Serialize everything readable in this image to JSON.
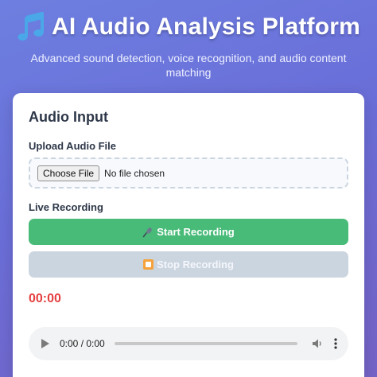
{
  "header": {
    "icon": "musical-notes-icon",
    "title": "AI Audio Analysis Platform",
    "subtitle": "Advanced sound detection, voice recognition, and audio content matching"
  },
  "audio_input": {
    "section_title": "Audio Input",
    "upload_label": "Upload Audio File",
    "choose_button": "Choose File",
    "no_file_text": "No file chosen",
    "live_label": "Live Recording",
    "start_button": "Start Recording",
    "start_icon": "microphone-icon",
    "stop_button": "Stop Recording",
    "stop_icon": "stop-icon",
    "timer": "00:00"
  },
  "player": {
    "time": "0:00 / 0:00",
    "progress": 0
  },
  "colors": {
    "start_button": "#48bb78",
    "stop_button_disabled": "#cbd5e0",
    "timer": "#e53e3e"
  }
}
